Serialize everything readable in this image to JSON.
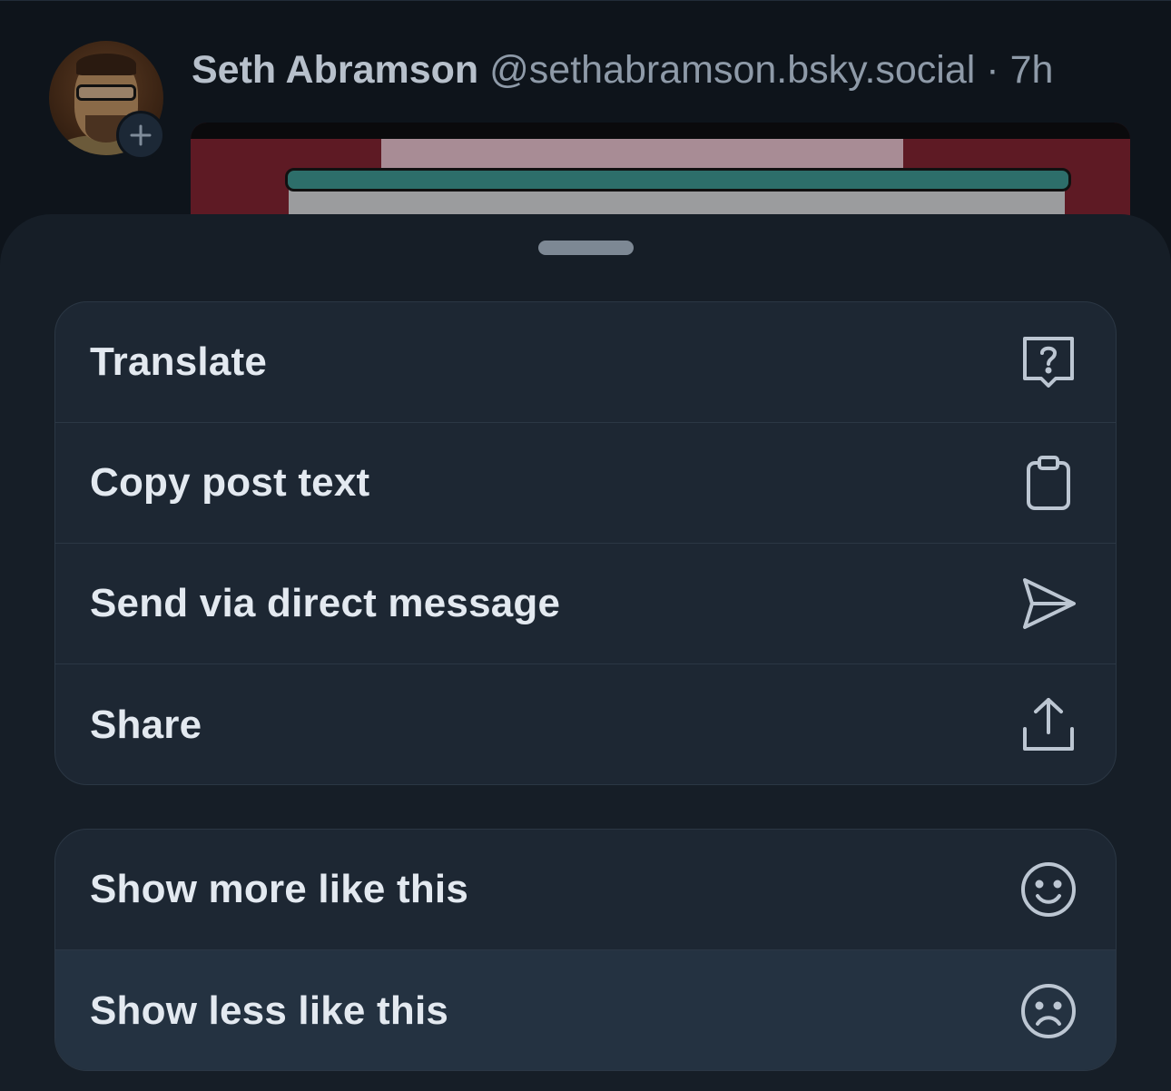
{
  "post": {
    "author_name": "Seth Abramson",
    "author_handle": "@sethabramson.bsky.social",
    "separator": " · ",
    "time_ago": "7h",
    "follow_icon": "plus-icon"
  },
  "menu": {
    "primary": [
      {
        "label": "Translate",
        "icon": "translate-icon"
      },
      {
        "label": "Copy post text",
        "icon": "clipboard-icon"
      },
      {
        "label": "Send via direct message",
        "icon": "send-icon"
      },
      {
        "label": "Share",
        "icon": "share-icon"
      }
    ],
    "feedback": [
      {
        "label": "Show more like this",
        "icon": "smile-icon"
      },
      {
        "label": "Show less like this",
        "icon": "frown-icon"
      }
    ]
  },
  "colors": {
    "sheet_bg": "#161e27",
    "group_bg": "#1d2733",
    "highlight_bg": "#243241",
    "text": "#e3e9f0",
    "icon": "#bcc6d2"
  }
}
